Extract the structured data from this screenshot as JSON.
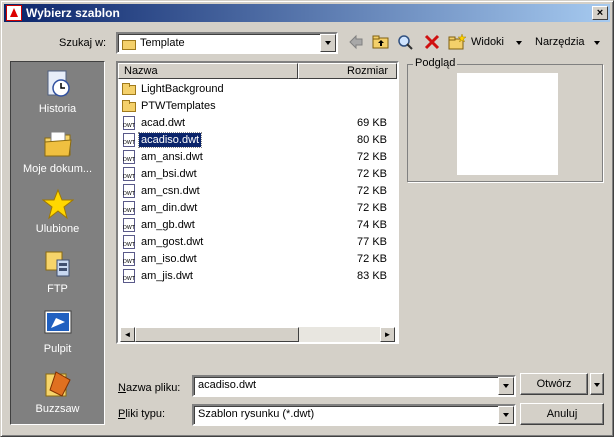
{
  "window": {
    "title": "Wybierz szablon"
  },
  "lookin": {
    "label": "Szukaj w:",
    "value": "Template"
  },
  "toolbar": {
    "views_label": "Widoki",
    "tools_label": "Narzędzia"
  },
  "places": [
    {
      "label": "Historia",
      "icon": "history-icon"
    },
    {
      "label": "Moje dokum...",
      "icon": "my-documents-icon"
    },
    {
      "label": "Ulubione",
      "icon": "favorites-star-icon"
    },
    {
      "label": "FTP",
      "icon": "ftp-icon"
    },
    {
      "label": "Pulpit",
      "icon": "desktop-icon"
    },
    {
      "label": "Buzzsaw",
      "icon": "buzzsaw-icon"
    }
  ],
  "filelist": {
    "columns": {
      "name": "Nazwa",
      "size": "Rozmiar"
    },
    "items": [
      {
        "name": "LightBackground",
        "size": "",
        "type": "folder"
      },
      {
        "name": "PTWTemplates",
        "size": "",
        "type": "folder"
      },
      {
        "name": "acad.dwt",
        "size": "69 KB",
        "type": "dwt"
      },
      {
        "name": "acadiso.dwt",
        "size": "80 KB",
        "type": "dwt"
      },
      {
        "name": "am_ansi.dwt",
        "size": "72 KB",
        "type": "dwt"
      },
      {
        "name": "am_bsi.dwt",
        "size": "72 KB",
        "type": "dwt"
      },
      {
        "name": "am_csn.dwt",
        "size": "72 KB",
        "type": "dwt"
      },
      {
        "name": "am_din.dwt",
        "size": "72 KB",
        "type": "dwt"
      },
      {
        "name": "am_gb.dwt",
        "size": "74 KB",
        "type": "dwt"
      },
      {
        "name": "am_gost.dwt",
        "size": "77 KB",
        "type": "dwt"
      },
      {
        "name": "am_iso.dwt",
        "size": "72 KB",
        "type": "dwt"
      },
      {
        "name": "am_jis.dwt",
        "size": "83 KB",
        "type": "dwt"
      }
    ],
    "selected": "acadiso.dwt"
  },
  "preview": {
    "label": "Podgląd"
  },
  "filename": {
    "label": "Nazwa pliku:",
    "value": "acadiso.dwt"
  },
  "filetype": {
    "label": "Pliki typu:",
    "value": "Szablon rysunku (*.dwt)"
  },
  "buttons": {
    "open": "Otwórz",
    "cancel": "Anuluj"
  }
}
